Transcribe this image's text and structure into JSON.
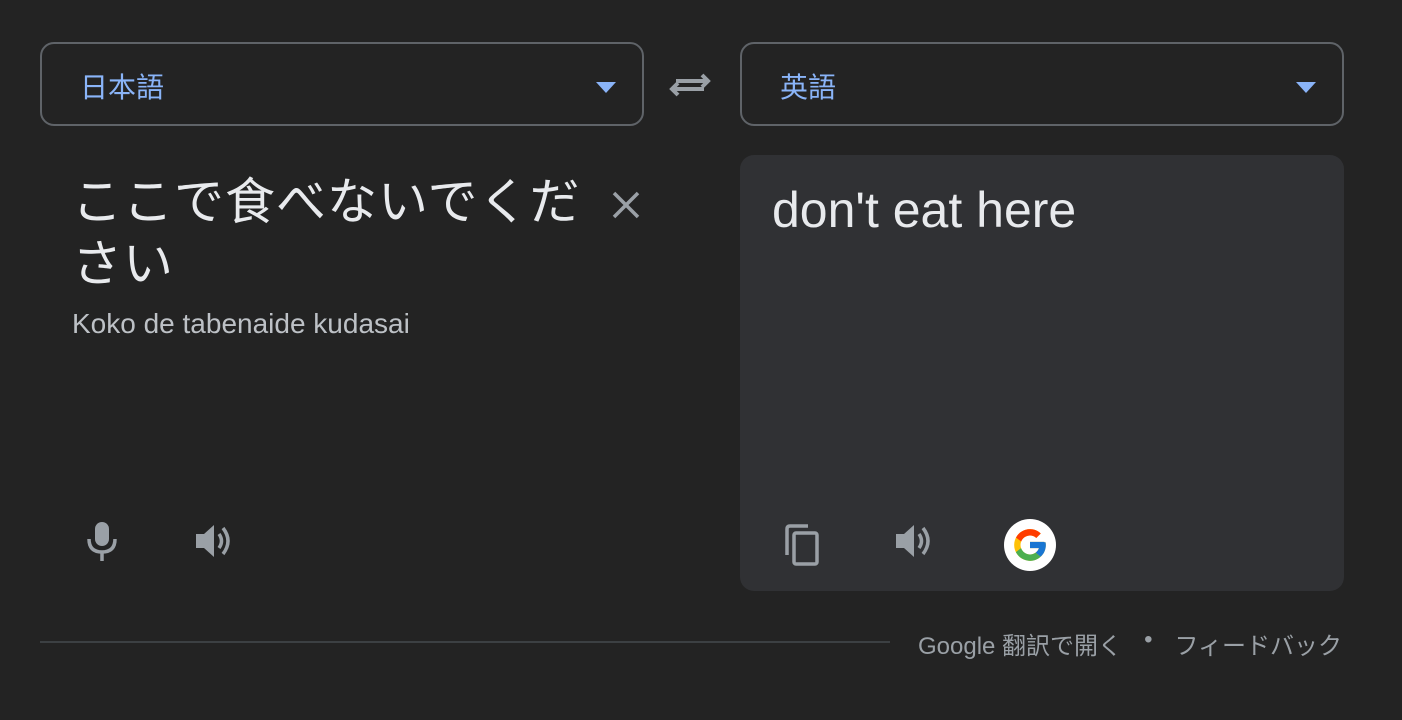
{
  "source_lang": {
    "label": "日本語"
  },
  "target_lang": {
    "label": "英語"
  },
  "source": {
    "text": "ここで食べないでください",
    "romanization": "Koko de tabenaide kudasai"
  },
  "target": {
    "text": "don't eat here"
  },
  "footer": {
    "open_link": "Google 翻訳で開く",
    "separator": "•",
    "feedback_link": "フィードバック"
  },
  "icons": {
    "swap": "swap-languages-icon",
    "clear": "close-icon",
    "mic": "microphone-icon",
    "speaker": "speaker-icon",
    "copy": "copy-icon",
    "google": "google-logo-icon"
  },
  "colors": {
    "background": "#232323",
    "accent": "#8ab4f8",
    "panel": "#303134",
    "text": "#e8eaed",
    "muted": "#9aa0a6"
  }
}
